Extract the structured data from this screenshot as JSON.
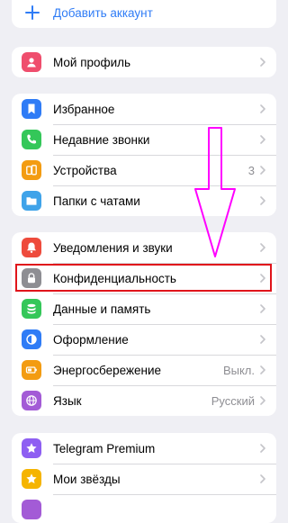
{
  "add_account": {
    "label": "Добавить аккаунт",
    "icon": "plus-icon",
    "color": "#2f7cf6"
  },
  "groups": [
    {
      "items": [
        {
          "label": "Мой профиль",
          "icon": "person-icon",
          "color": "#ef4e6d"
        }
      ]
    },
    {
      "items": [
        {
          "label": "Избранное",
          "icon": "bookmark-icon",
          "color": "#2f7cf6"
        },
        {
          "label": "Недавние звонки",
          "icon": "phone-icon",
          "color": "#34c759"
        },
        {
          "label": "Устройства",
          "icon": "devices-icon",
          "color": "#f39c12",
          "value": "3"
        },
        {
          "label": "Папки с чатами",
          "icon": "folder-icon",
          "color": "#3fa3e9"
        }
      ]
    },
    {
      "items": [
        {
          "label": "Уведомления и звуки",
          "icon": "bell-icon",
          "color": "#ee4b3c"
        },
        {
          "label": "Конфиденциальность",
          "icon": "lock-icon",
          "color": "#8e8e93",
          "highlighted": true
        },
        {
          "label": "Данные и память",
          "icon": "database-icon",
          "color": "#34c759"
        },
        {
          "label": "Оформление",
          "icon": "appearance-icon",
          "color": "#2f7cf6"
        },
        {
          "label": "Энергосбережение",
          "icon": "battery-icon",
          "color": "#f39c12",
          "value": "Выкл."
        },
        {
          "label": "Язык",
          "icon": "globe-icon",
          "color": "#a35bd6",
          "value": "Русский"
        }
      ]
    },
    {
      "items": [
        {
          "label": "Telegram Premium",
          "icon": "star-icon",
          "color": "#8e5ff2"
        },
        {
          "label": "Мои звёзды",
          "icon": "star-icon",
          "color": "#f5b400"
        }
      ]
    }
  ],
  "annotation": {
    "arrow_color": "#ff00ff",
    "highlight_color": "#e0141b"
  }
}
